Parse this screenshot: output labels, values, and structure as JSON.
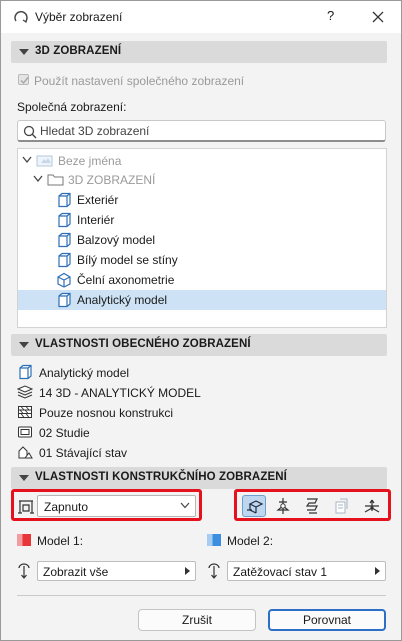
{
  "window": {
    "title": "Výběr zobrazení",
    "help_label": "?",
    "close_icon": "close-icon"
  },
  "section_3d": {
    "label": "3D ZOBRAZENÍ"
  },
  "use_common_checkbox": {
    "label": "Použít nastavení společného zobrazení",
    "checked": true,
    "enabled": false
  },
  "common_views_label": "Společná zobrazení:",
  "search": {
    "placeholder": "Hledat 3D zobrazení"
  },
  "tree": [
    {
      "label": "Beze jména",
      "icon": "dimmed-view-icon",
      "muted": true
    },
    {
      "label": "3D ZOBRAZENÍ",
      "icon": "folder-icon",
      "muted": true
    },
    {
      "label": "Exteriér",
      "icon": "3d-view-icon"
    },
    {
      "label": "Interiér",
      "icon": "3d-view-icon"
    },
    {
      "label": "Balzový model",
      "icon": "3d-view-icon"
    },
    {
      "label": "Bílý model se stíny",
      "icon": "3d-view-icon"
    },
    {
      "label": "Čelní axonometrie",
      "icon": "axonometry-icon"
    },
    {
      "label": "Analytický model",
      "icon": "3d-view-icon",
      "selected": true
    }
  ],
  "section_general": {
    "label": "VLASTNOSTI OBECNÉHO ZOBRAZENÍ"
  },
  "general_props": [
    {
      "icon": "view-name-icon",
      "text": "Analytický model"
    },
    {
      "icon": "layer-combination-icon",
      "text": "14 3D - ANALYTICKÝ MODEL"
    },
    {
      "icon": "structural-display-icon",
      "text": "Pouze nosnou konstrukci"
    },
    {
      "icon": "graphic-override-icon",
      "text": "02 Studie"
    },
    {
      "icon": "renovation-filter-icon",
      "text": "01 Stávající stav"
    }
  ],
  "section_structural": {
    "label": "VLASTNOSTI KONSTRUKČNÍHO ZOBRAZENÍ"
  },
  "structural_toggle": {
    "value": "Zapnuto",
    "icon": "analytical-model-icon"
  },
  "tool_buttons": [
    {
      "name": "analytical-view-icon",
      "active": true
    },
    {
      "name": "supports-icon",
      "active": false
    },
    {
      "name": "releases-icon",
      "active": false
    },
    {
      "name": "load-icon",
      "active": false,
      "disabled": true
    },
    {
      "name": "axes-icon",
      "active": false
    }
  ],
  "model1": {
    "label": "Model 1:",
    "color": "#e8353a",
    "value": "Zobrazit vše"
  },
  "model2": {
    "label": "Model 2:",
    "color": "#3d8ee0",
    "value": "Zatěžovací stav 1"
  },
  "buttons": {
    "cancel": "Zrušit",
    "ok": "Porovnat"
  }
}
